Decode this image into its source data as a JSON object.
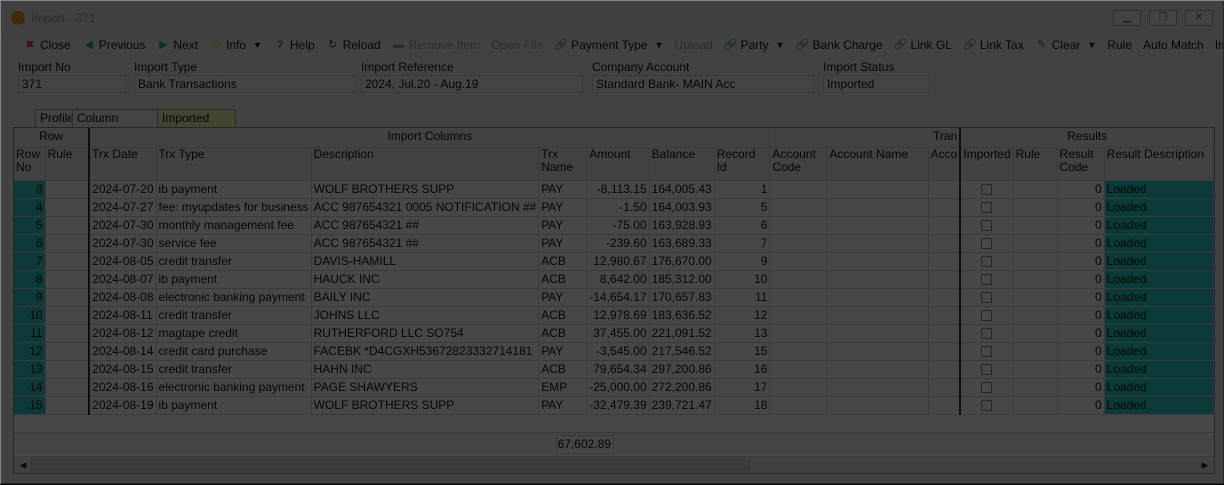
{
  "window": {
    "title": "Import - 371"
  },
  "toolbar": [
    {
      "label": "Close",
      "icon": "✖",
      "color": "#d33"
    },
    {
      "label": "Previous",
      "icon": "◀",
      "color": "#2a8"
    },
    {
      "label": "Next",
      "icon": "▶",
      "color": "#2a8"
    },
    {
      "label": "Info",
      "icon": "☺",
      "color": "#db0",
      "dropdown": true
    },
    {
      "label": "Help",
      "icon": "?",
      "color": "#226"
    },
    {
      "label": "Reload",
      "icon": "↻",
      "color": "#333"
    },
    {
      "label": "Remove Item",
      "icon": "▬",
      "color": "#999",
      "disabled": true
    },
    {
      "label": "Open File",
      "icon": "",
      "color": "#999",
      "disabled": true
    },
    {
      "label": "Payment Type",
      "icon": "🔗",
      "color": "#c80",
      "dropdown": true
    },
    {
      "label": "Upload",
      "icon": "",
      "color": "#999",
      "disabled": true
    },
    {
      "label": "Party",
      "icon": "🔗",
      "color": "#c80",
      "dropdown": true
    },
    {
      "label": "Bank Charge",
      "icon": "🔗",
      "color": "#c80"
    },
    {
      "label": "Link GL",
      "icon": "🔗",
      "color": "#c80"
    },
    {
      "label": "Link Tax",
      "icon": "🔗",
      "color": "#c80"
    },
    {
      "label": "Clear",
      "icon": "✎",
      "color": "#c33",
      "dropdown": true
    },
    {
      "label": "Rule",
      "icon": "",
      "color": "#333"
    },
    {
      "label": "Auto Match",
      "icon": "",
      "color": "#333"
    },
    {
      "label": "Import",
      "icon": "",
      "color": "#333"
    }
  ],
  "fields": {
    "import_no": {
      "label": "Import No",
      "value": "371"
    },
    "import_type": {
      "label": "Import Type",
      "value": "Bank Transactions"
    },
    "import_reference": {
      "label": "Import Reference",
      "value": "2024, Jul.20 - Aug.19"
    },
    "company_account": {
      "label": "Company Account",
      "value": "Standard Bank- MAIN Acc"
    },
    "import_status": {
      "label": "Import Status",
      "value": "Imported"
    }
  },
  "tabs": [
    "Profile",
    "Column Mapping",
    "Imported Data"
  ],
  "grid": {
    "groups": [
      "Row",
      "Import Columns",
      "Tran",
      "Results"
    ],
    "headers": [
      "Row No",
      "Rule",
      "Trx Date",
      "Trx Type",
      "Description",
      "Trx Name",
      "Amount",
      "Balance",
      "Record Id",
      "Account Code",
      "Account Name",
      "Acco",
      "Imported",
      "Rule",
      "Result Code",
      "Result Description"
    ],
    "rows": [
      [
        "3",
        "",
        "2024-07-20",
        "ib payment",
        "WOLF BROTHERS SUPP",
        "PAY",
        "-8,113.15",
        "164,005.43",
        "1",
        "",
        "",
        "",
        "",
        "",
        "0",
        "Loaded"
      ],
      [
        "4",
        "",
        "2024-07-27",
        "fee: myupdates for business",
        "ACC 987654321 0005 NOTIFICATION ##",
        "PAY",
        "-1.50",
        "164,003.93",
        "5",
        "",
        "",
        "",
        "",
        "",
        "0",
        "Loaded"
      ],
      [
        "5",
        "",
        "2024-07-30",
        "monthly management fee",
        "ACC   987654321 ##",
        "PAY",
        "-75.00",
        "163,928.93",
        "6",
        "",
        "",
        "",
        "",
        "",
        "0",
        "Loaded"
      ],
      [
        "6",
        "",
        "2024-07-30",
        "service fee",
        "ACC   987654321 ##",
        "PAY",
        "-239.60",
        "163,689.33",
        "7",
        "",
        "",
        "",
        "",
        "",
        "0",
        "Loaded"
      ],
      [
        "7",
        "",
        "2024-08-05",
        "credit transfer",
        "DAVIS-HAMILL",
        "ACB",
        "12,980.67",
        "176,670.00",
        "9",
        "",
        "",
        "",
        "",
        "",
        "0",
        "Loaded"
      ],
      [
        "8",
        "",
        "2024-08-07",
        "ib payment",
        "HAUCK INC",
        "ACB",
        "8,642.00",
        "185,312.00",
        "10",
        "",
        "",
        "",
        "",
        "",
        "0",
        "Loaded"
      ],
      [
        "9",
        "",
        "2024-08-08",
        "electronic banking payment",
        "BAILY INC",
        "PAY",
        "-14,654.17",
        "170,657.83",
        "11",
        "",
        "",
        "",
        "",
        "",
        "0",
        "Loaded"
      ],
      [
        "10",
        "",
        "2024-08-11",
        "credit transfer",
        "JOHNS LLC",
        "ACB",
        "12,978.69",
        "183,636.52",
        "12",
        "",
        "",
        "",
        "",
        "",
        "0",
        "Loaded"
      ],
      [
        "11",
        "",
        "2024-08-12",
        "magtape credit",
        "RUTHERFORD LLC SO754",
        "ACB",
        "37,455.00",
        "221,091.52",
        "13",
        "",
        "",
        "",
        "",
        "",
        "0",
        "Loaded"
      ],
      [
        "12",
        "",
        "2024-08-14",
        "credit card purchase",
        "FACEBK *D4CGXH53672823332714181",
        "PAY",
        "-3,545.00",
        "217,546.52",
        "15",
        "",
        "",
        "",
        "",
        "",
        "0",
        "Loaded"
      ],
      [
        "13",
        "",
        "2024-08-15",
        "credit transfer",
        "HAHN INC",
        "ACB",
        "79,654.34",
        "297,200.86",
        "16",
        "",
        "",
        "",
        "",
        "",
        "0",
        "Loaded"
      ],
      [
        "14",
        "",
        "2024-08-16",
        "electronic banking payment",
        "PAGE SHAWYERS",
        "EMP",
        "-25,000.00",
        "272,200.86",
        "17",
        "",
        "",
        "",
        "",
        "",
        "0",
        "Loaded"
      ],
      [
        "15",
        "",
        "2024-08-19",
        "ib payment",
        "WOLF BROTHERS SUPP",
        "PAY",
        "-32,479.39",
        "239,721.47",
        "18",
        "",
        "",
        "",
        "",
        "",
        "0",
        "Loaded"
      ]
    ],
    "total_amount": "67,602.89"
  }
}
